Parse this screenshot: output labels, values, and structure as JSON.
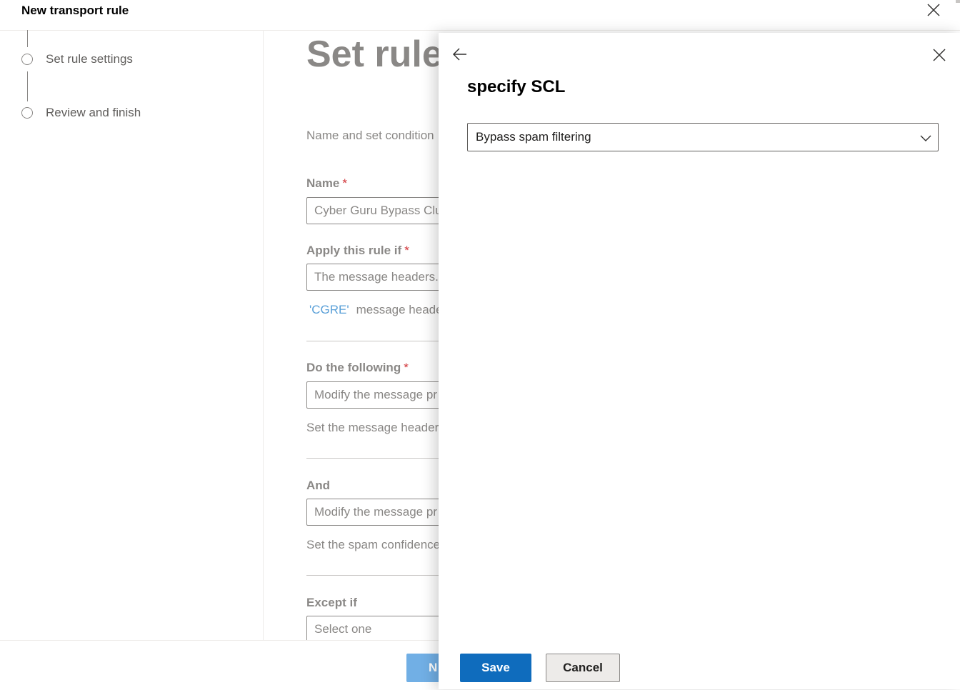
{
  "window": {
    "title": "New transport rule"
  },
  "steps": [
    {
      "label": "Set rule settings"
    },
    {
      "label": "Review and finish"
    }
  ],
  "form": {
    "heading": "Set rule",
    "description": "Name and set condition",
    "name_label": "Name",
    "name_value": "Cyber Guru Bypass Clu",
    "apply_label": "Apply this rule if",
    "apply_value": "The message headers...",
    "apply_sub_link": "'CGRE'",
    "apply_sub_text": "message heade",
    "do_label": "Do the following",
    "do_value": "Modify the message pr",
    "do_sub": "Set the message header",
    "and_label": "And",
    "and_value": "Modify the message pr",
    "and_sub": "Set the spam confidence",
    "except_label": "Except if",
    "except_value": "Select one",
    "required_mark": "*"
  },
  "footer": {
    "next_label": "N"
  },
  "panel": {
    "title": "specify SCL",
    "dropdown_value": "Bypass spam filtering",
    "save_label": "Save",
    "cancel_label": "Cancel"
  },
  "icons": {
    "close": "close-icon",
    "back": "arrow-left-icon",
    "chevron": "chevron-down-icon"
  },
  "colors": {
    "primary": "#0f6cbd",
    "disabled_primary": "#71afe5",
    "required": "#d13438",
    "link": "#5aa0d8"
  }
}
